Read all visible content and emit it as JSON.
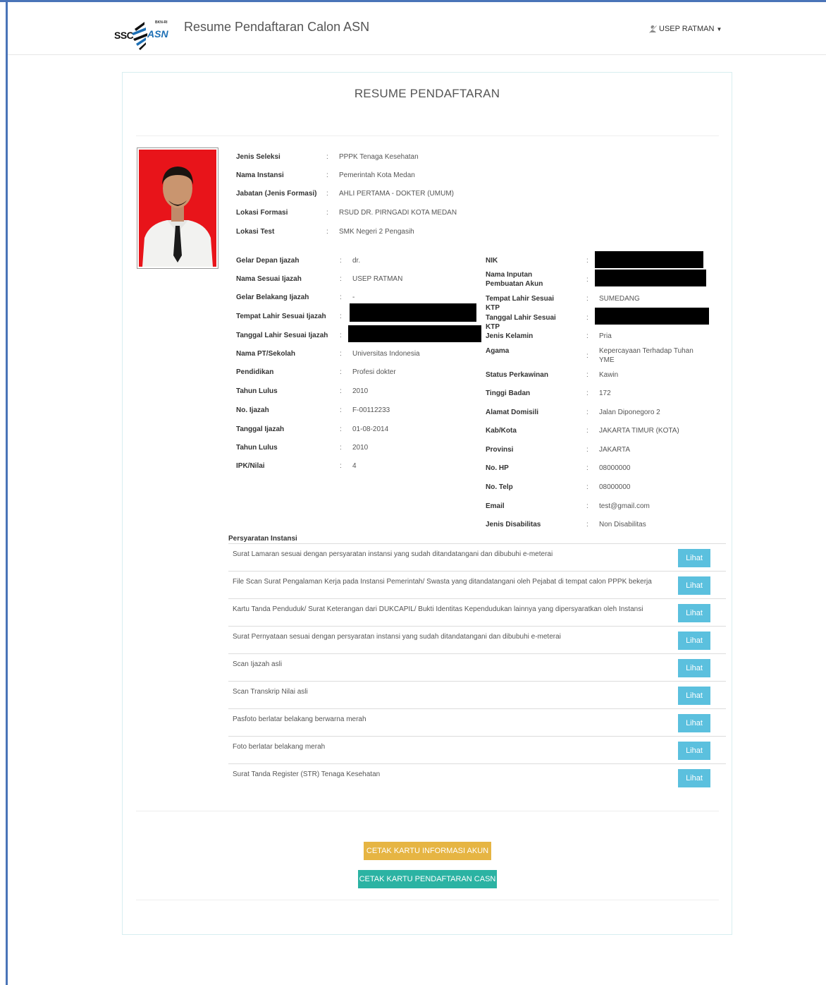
{
  "header": {
    "logo_text_ssc": "SSC",
    "logo_text_asn": "ASN",
    "logo_text_bkn": "BKN-RI",
    "title": "Resume Pendaftaran Calon ASN",
    "user_name": "USEP RATMAN"
  },
  "panel": {
    "title": "RESUME PENDAFTARAN"
  },
  "formasi": [
    {
      "label": "Jenis Seleksi",
      "value": "PPPK Tenaga Kesehatan"
    },
    {
      "label": "Nama Instansi",
      "value": "Pemerintah Kota Medan"
    },
    {
      "label": "Jabatan (Jenis Formasi)",
      "value": "AHLI PERTAMA - DOKTER (UMUM)"
    },
    {
      "label": "Lokasi Formasi",
      "value": "RSUD DR. PIRNGADI KOTA MEDAN"
    },
    {
      "label": "Lokasi Test",
      "value": "SMK Negeri 2 Pengasih"
    }
  ],
  "pendidikan": [
    {
      "label": "Gelar Depan Ijazah",
      "value": "dr."
    },
    {
      "label": "Nama Sesuai Ijazah",
      "value": "USEP RATMAN"
    },
    {
      "label": "Gelar Belakang Ijazah",
      "value": "-"
    },
    {
      "label": "Tempat Lahir Sesuai Ijazah",
      "value": ""
    },
    {
      "label": "Tanggal Lahir Sesuai Ijazah",
      "value": ""
    },
    {
      "label": "Nama PT/Sekolah",
      "value": "Universitas Indonesia"
    },
    {
      "label": "Pendidikan",
      "value": "Profesi dokter"
    },
    {
      "label": "Tahun Lulus",
      "value": "2010"
    },
    {
      "label": "No. Ijazah",
      "value": "F-00112233"
    },
    {
      "label": "Tanggal Ijazah",
      "value": "01-08-2014"
    },
    {
      "label": "Tahun Lulus",
      "value": "2010"
    },
    {
      "label": "IPK/Nilai",
      "value": "4"
    }
  ],
  "identitas": [
    {
      "label": "NIK",
      "value": ""
    },
    {
      "label": "Nama Inputan Pembuatan Akun",
      "value": ""
    },
    {
      "label": "Tempat Lahir Sesuai KTP",
      "value": "SUMEDANG"
    },
    {
      "label": "Tanggal Lahir Sesuai KTP",
      "value": ""
    },
    {
      "label": "Jenis Kelamin",
      "value": "Pria"
    },
    {
      "label": "Agama",
      "value": "Kepercayaan Terhadap Tuhan YME"
    },
    {
      "label": "Status Perkawinan",
      "value": "Kawin"
    },
    {
      "label": "Tinggi Badan",
      "value": "172"
    },
    {
      "label": "Alamat Domisili",
      "value": "Jalan Diponegoro 2"
    },
    {
      "label": "Kab/Kota",
      "value": "JAKARTA TIMUR (KOTA)"
    },
    {
      "label": "Provinsi",
      "value": "JAKARTA"
    },
    {
      "label": "No. HP",
      "value": "08000000"
    },
    {
      "label": "No. Telp",
      "value": "08000000"
    },
    {
      "label": "Email",
      "value": "test@gmail.com"
    },
    {
      "label": "Jenis Disabilitas",
      "value": "Non Disabilitas"
    }
  ],
  "persyaratan": {
    "title": "Persyaratan Instansi",
    "button_label": "Lihat",
    "items": [
      "Surat Lamaran sesuai dengan persyaratan instansi yang sudah ditandatangani dan dibubuhi e-meterai",
      "File Scan Surat Pengalaman Kerja pada Instansi Pemerintah/ Swasta yang ditandatangani oleh Pejabat di tempat calon PPPK bekerja",
      "Kartu Tanda Penduduk/ Surat Keterangan dari DUKCAPIL/ Bukti Identitas Kependudukan lainnya yang dipersyaratkan oleh Instansi",
      "Surat Pernyataan sesuai dengan persyaratan instansi yang sudah ditandatangani dan dibubuhi e-meterai",
      "Scan Ijazah asli",
      "Scan Transkrip Nilai asli",
      "Pasfoto berlatar belakang berwarna merah",
      "Foto berlatar belakang merah",
      "Surat Tanda Register (STR) Tenaga Kesehatan"
    ]
  },
  "actions": {
    "cetak_akun": "CETAK KARTU INFORMASI AKUN",
    "cetak_casn": "CETAK KARTU PENDAFTARAN CASN"
  },
  "colors": {
    "frame": "#4a74b8",
    "btn_lihat": "#5bc0de",
    "btn_akun": "#e6b543",
    "btn_casn": "#2bb3a3",
    "photo_bg": "#e8141a"
  },
  "icons": {
    "user": "user-icon",
    "caret": "caret-down-icon"
  }
}
